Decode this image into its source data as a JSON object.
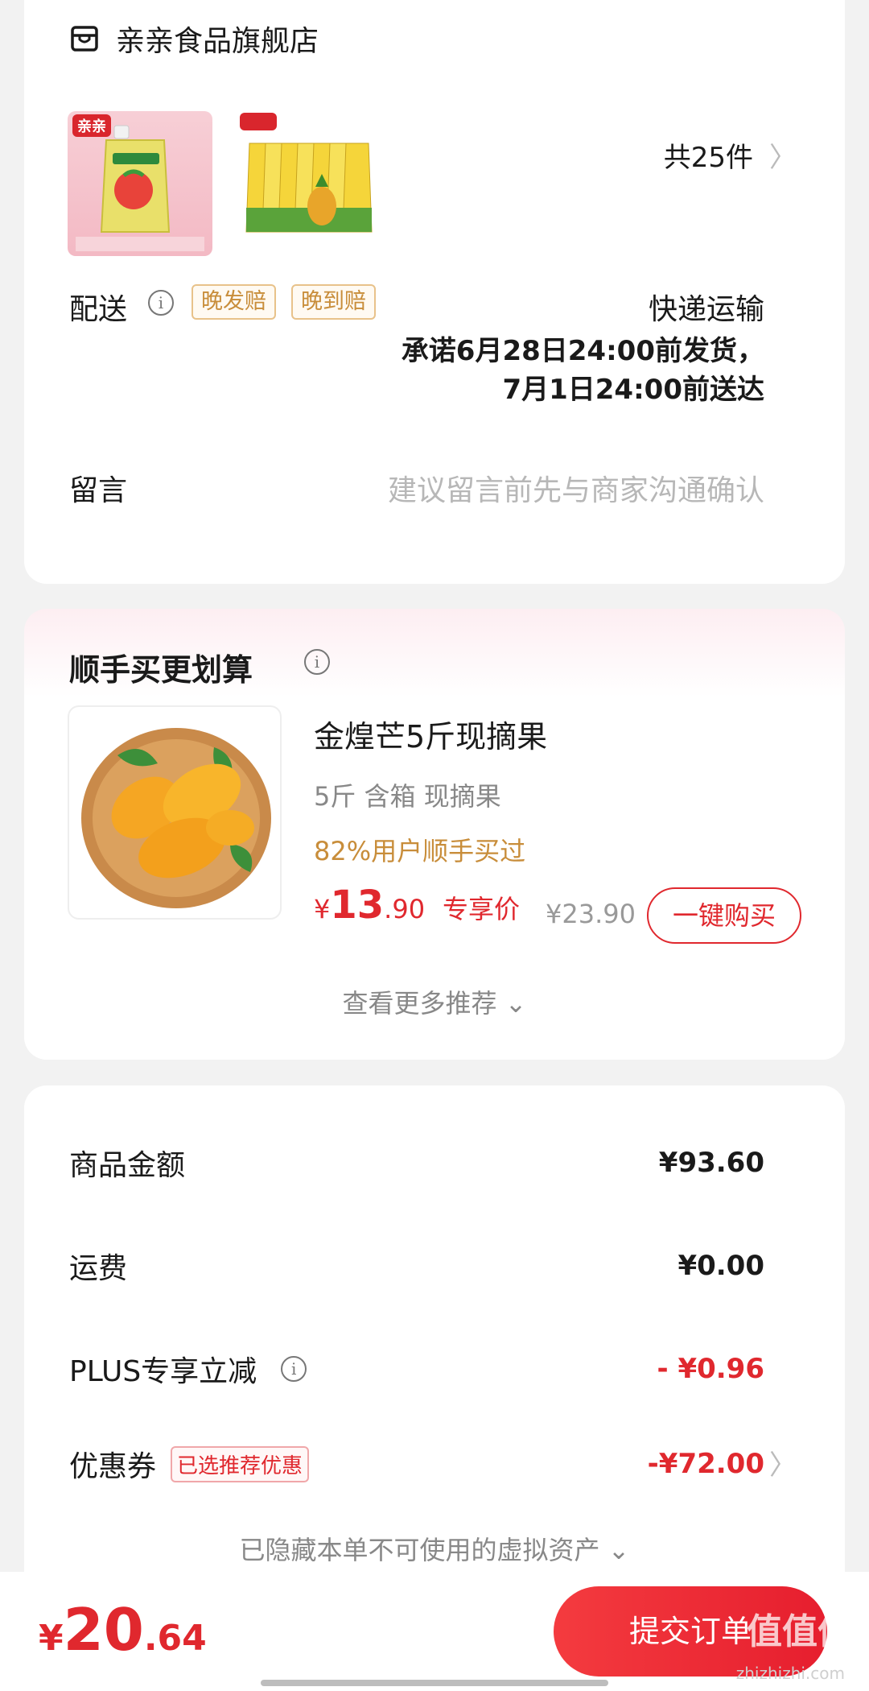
{
  "shop": {
    "name": "亲亲食品旗舰店",
    "thumb_brand": "亲亲",
    "item_count": "共25件"
  },
  "delivery": {
    "label": "配送",
    "tag_late_ship": "晚发赔",
    "tag_late_arrive": "晚到赔",
    "method": "快递运输",
    "promise_line1": "承诺6月28日24:00前发货，",
    "promise_line2": "7月1日24:00前送达"
  },
  "message": {
    "label": "留言",
    "placeholder": "建议留言前先与商家沟通确认"
  },
  "recommend": {
    "title": "顺手买更划算",
    "product_name": "金煌芒5斤现摘果",
    "spec": "5斤 含箱 现摘果",
    "social_proof": "82%用户顺手买过",
    "price_currency": "¥",
    "price_int": "13",
    "price_dec": ".90",
    "price_label": "专享价",
    "original_price": "¥23.90",
    "buy_button": "一键购买",
    "more": "查看更多推荐 ⌄"
  },
  "summary": {
    "goods_label": "商品金额",
    "goods_value": "¥93.60",
    "shipping_label": "运费",
    "shipping_value": "¥0.00",
    "plus_label": "PLUS专享立减",
    "plus_value": "- ¥0.96",
    "coupon_label": "优惠券",
    "coupon_tag": "已选推荐优惠",
    "coupon_value": "-¥72.00",
    "hidden_assets": "已隐藏本单不可使用的虚拟资产 ⌄"
  },
  "footer": {
    "total_currency": "¥",
    "total_int": "20",
    "total_dec": ".64",
    "submit": "提交订单",
    "watermark": "值值值",
    "watermark_url": "zhizhizhi.com"
  },
  "icons": {
    "shop": "store-icon",
    "info": "info-icon",
    "chevron": "chevron-right-icon"
  },
  "colors": {
    "accent_red": "#e0282e",
    "tag_orange": "#c88d3a",
    "page_bg": "#f2f2f2"
  }
}
